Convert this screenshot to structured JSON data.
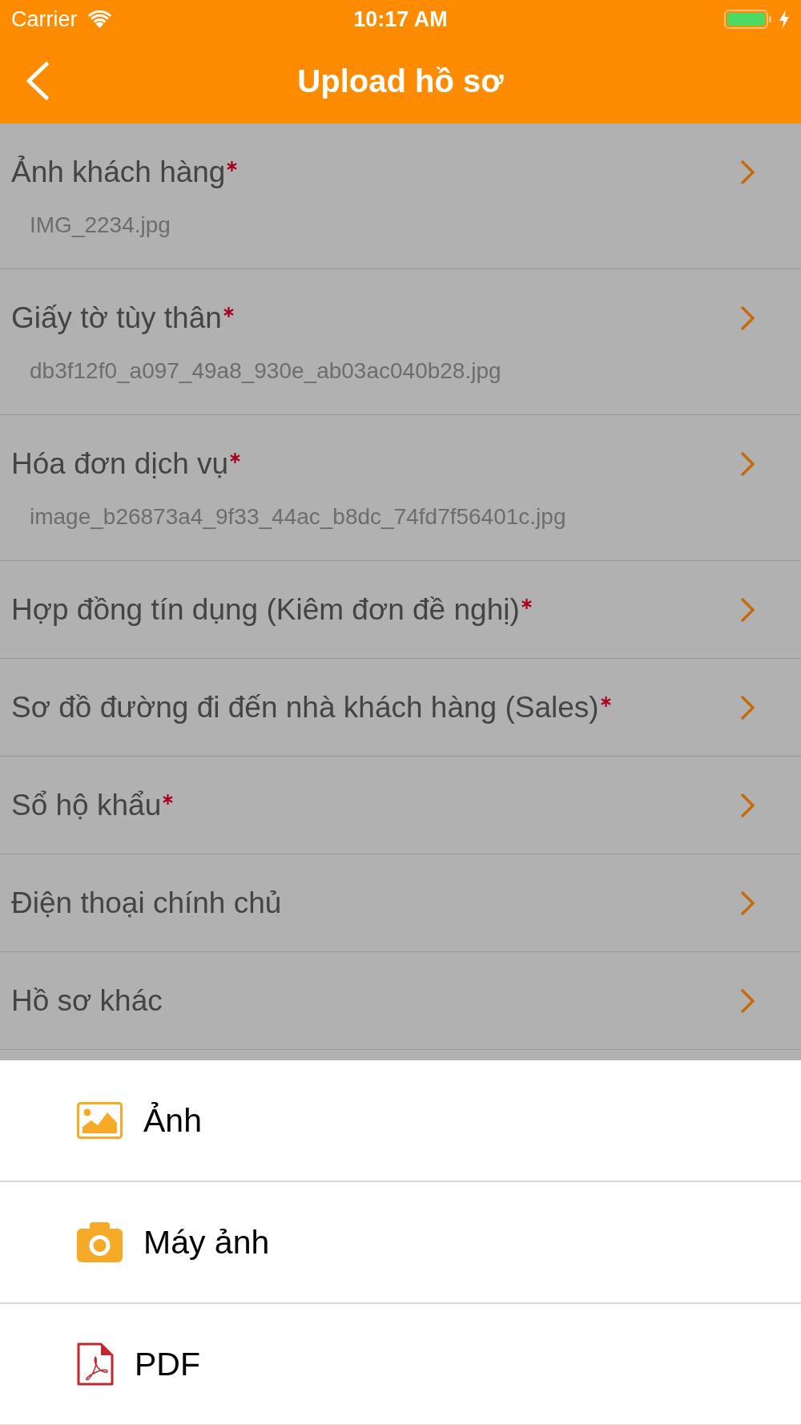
{
  "status_bar": {
    "carrier": "Carrier",
    "time": "10:17 AM"
  },
  "nav_bar": {
    "title": "Upload hồ sơ"
  },
  "documents": [
    {
      "title": "Ảnh khách hàng",
      "required": true,
      "filename": "IMG_2234.jpg"
    },
    {
      "title": "Giấy tờ tùy thân",
      "required": true,
      "filename": "db3f12f0_a097_49a8_930e_ab03ac040b28.jpg"
    },
    {
      "title": "Hóa đơn dịch vụ",
      "required": true,
      "filename": "image_b26873a4_9f33_44ac_b8dc_74fd7f56401c.jpg"
    },
    {
      "title": "Hợp đồng tín dụng (Kiêm đơn đề nghị)",
      "required": true
    },
    {
      "title": "Sơ đồ đường đi đến nhà khách hàng (Sales)",
      "required": true
    },
    {
      "title": "Sổ hộ khẩu",
      "required": true
    },
    {
      "title": "Điện thoại chính chủ",
      "required": false
    },
    {
      "title": "Hồ sơ khác",
      "required": false
    }
  ],
  "action_sheet": {
    "options": [
      {
        "kind": "gallery",
        "label": "Ảnh"
      },
      {
        "kind": "camera",
        "label": "Máy ảnh"
      },
      {
        "kind": "pdf",
        "label": "PDF"
      }
    ]
  }
}
